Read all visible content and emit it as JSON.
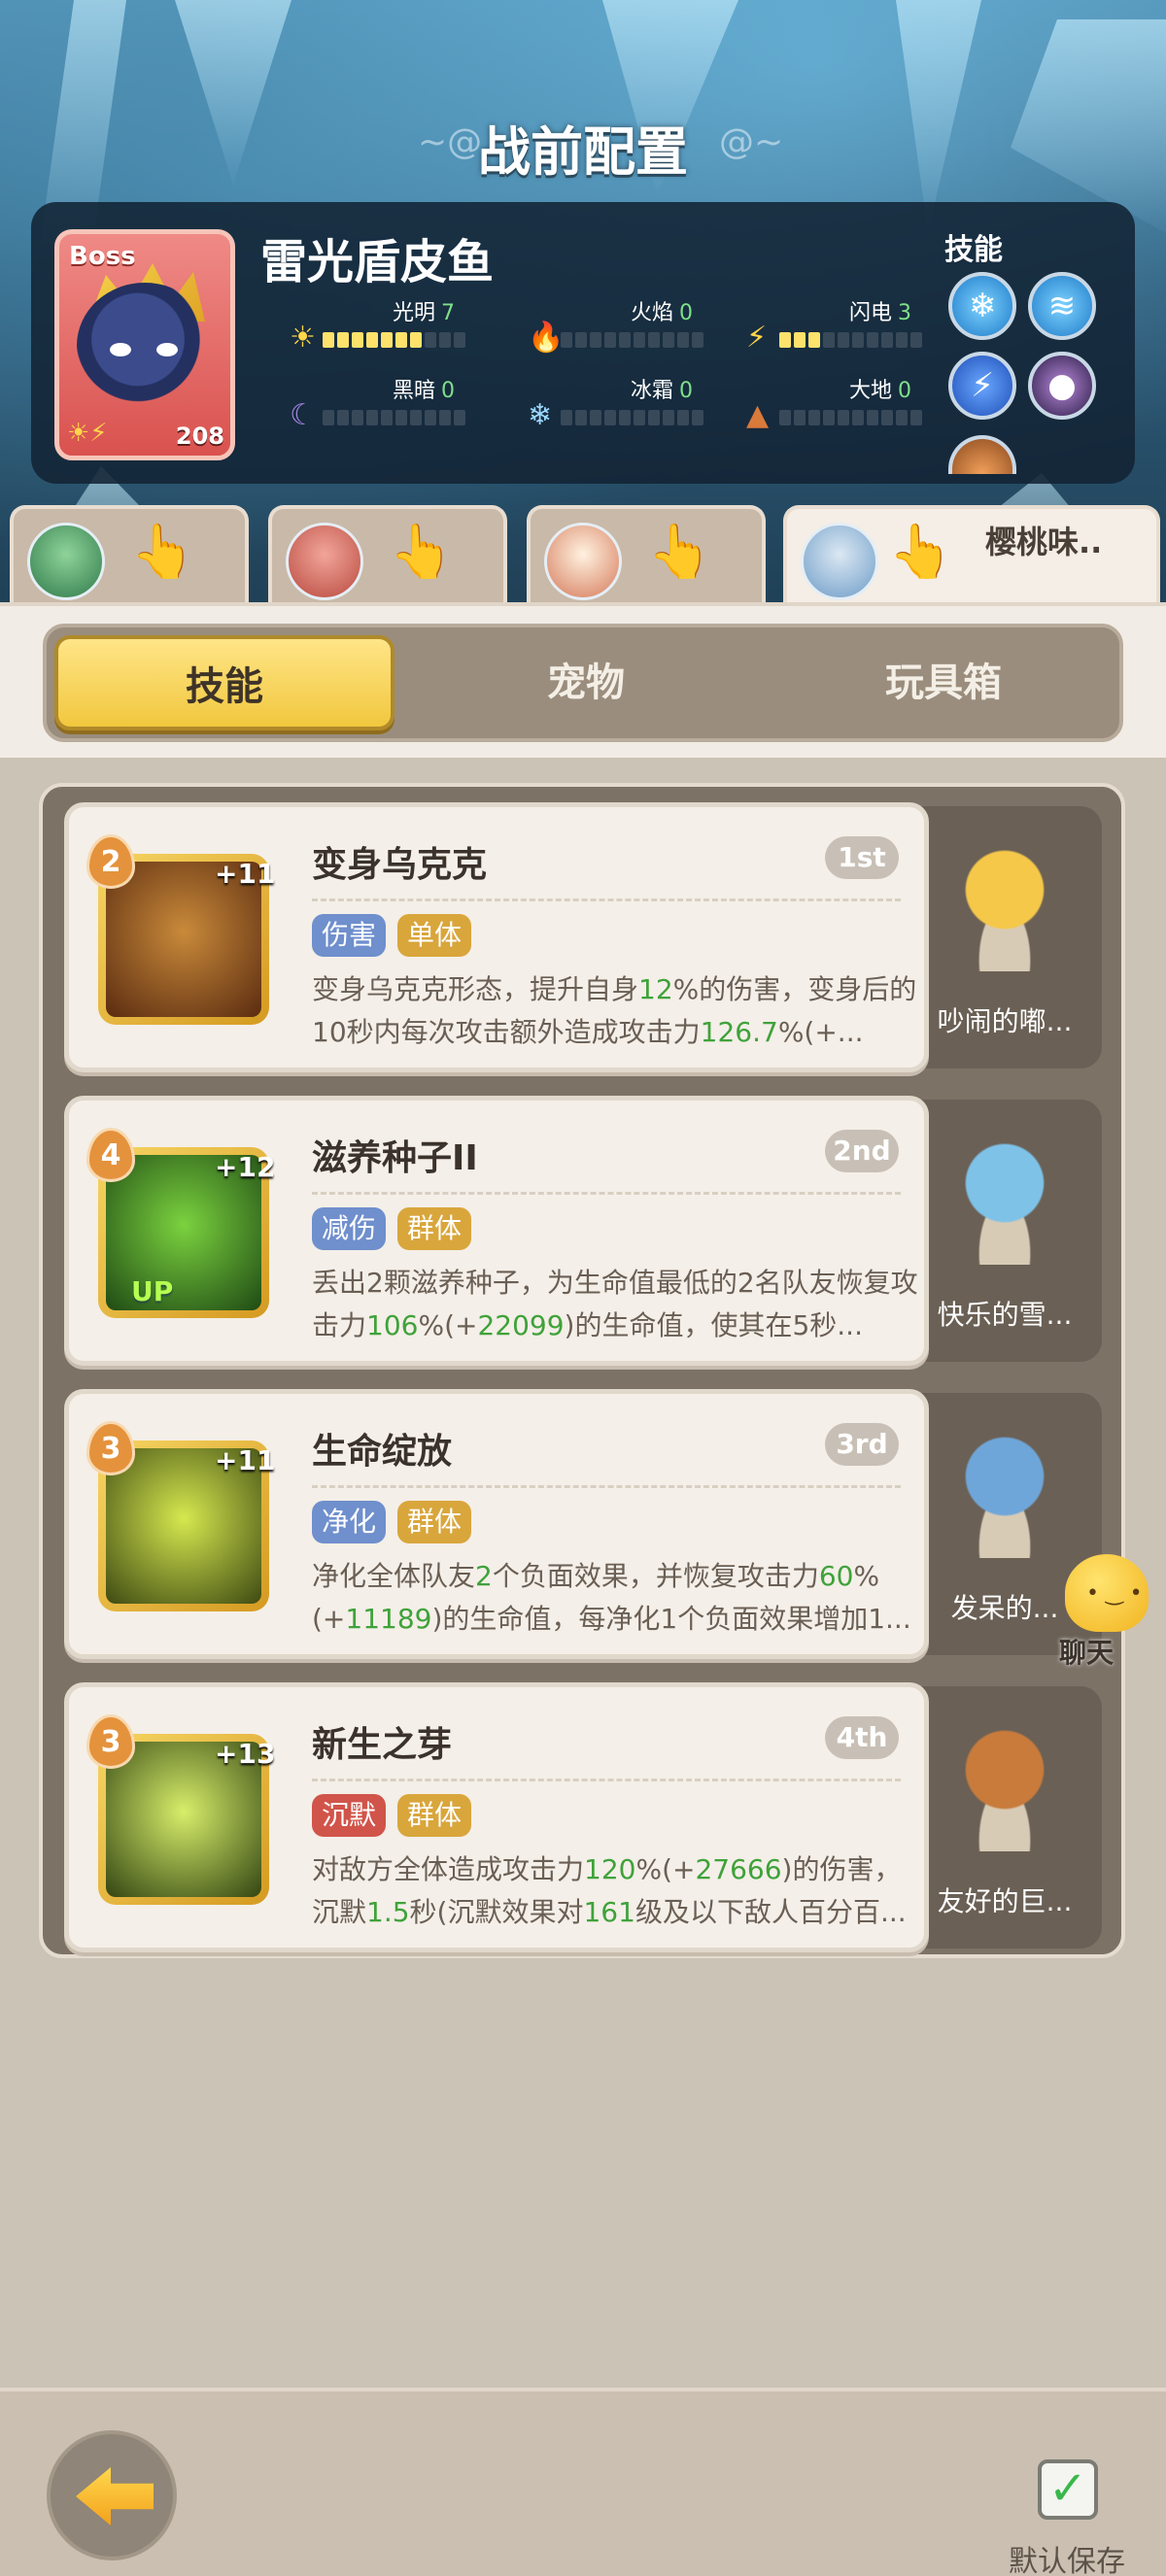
{
  "header": {
    "title": "战前配置"
  },
  "boss": {
    "badge": "Boss",
    "name": "雷光盾皮鱼",
    "level": "208",
    "stats": [
      {
        "label": "光明",
        "value": "7",
        "fill": 7,
        "icon": "sun-icon"
      },
      {
        "label": "火焰",
        "value": "0",
        "fill": 0,
        "icon": "fire-icon"
      },
      {
        "label": "闪电",
        "value": "3",
        "fill": 3,
        "icon": "lightning-icon"
      },
      {
        "label": "黑暗",
        "value": "0",
        "fill": 0,
        "icon": "moon-icon"
      },
      {
        "label": "冰霜",
        "value": "0",
        "fill": 0,
        "icon": "snowflake-icon"
      },
      {
        "label": "大地",
        "value": "0",
        "fill": 0,
        "icon": "earth-icon"
      }
    ],
    "skills_label": "技能"
  },
  "team": {
    "slots": [
      {
        "name": ""
      },
      {
        "name": ""
      },
      {
        "name": ""
      },
      {
        "name": "樱桃味.."
      }
    ]
  },
  "tabs": {
    "items": [
      "技能",
      "宠物",
      "玩具箱"
    ],
    "active": 0
  },
  "skills": [
    {
      "name": "变身乌克克",
      "rank": "1st",
      "level": "2",
      "plus": "+11",
      "tags": [
        {
          "text": "伤害",
          "color": "blue"
        },
        {
          "text": "单体",
          "color": "gold"
        }
      ],
      "desc": [
        {
          "t": "变身乌克克形态，提升自身"
        },
        {
          "t": "12",
          "g": true
        },
        {
          "t": "%的伤害，变身后的10秒内每次攻击额外造成攻击力"
        },
        {
          "t": "126.7",
          "g": true
        },
        {
          "t": "%(+..."
        }
      ],
      "pet": "吵闹的嘟..."
    },
    {
      "name": "滋养种子II",
      "rank": "2nd",
      "level": "4",
      "plus": "+12",
      "up": "UP",
      "tags": [
        {
          "text": "减伤",
          "color": "blue"
        },
        {
          "text": "群体",
          "color": "gold"
        }
      ],
      "desc": [
        {
          "t": "丢出2颗滋养种子，为生命值最低的2名队友恢复攻击力"
        },
        {
          "t": "106",
          "g": true
        },
        {
          "t": "%(+"
        },
        {
          "t": "22099",
          "g": true
        },
        {
          "t": ")的生命值，使其在5秒..."
        }
      ],
      "pet": "快乐的雪..."
    },
    {
      "name": "生命绽放",
      "rank": "3rd",
      "level": "3",
      "plus": "+11",
      "tags": [
        {
          "text": "净化",
          "color": "blue"
        },
        {
          "text": "群体",
          "color": "gold"
        }
      ],
      "desc": [
        {
          "t": "净化全体队友"
        },
        {
          "t": "2",
          "g": true
        },
        {
          "t": "个负面效果，并恢复攻击力"
        },
        {
          "t": "60",
          "g": true
        },
        {
          "t": "%(+"
        },
        {
          "t": "11189",
          "g": true
        },
        {
          "t": ")的生命值，每净化1个负面效果增加1..."
        }
      ],
      "pet": "发呆的..."
    },
    {
      "name": "新生之芽",
      "rank": "4th",
      "level": "3",
      "plus": "+13",
      "tags": [
        {
          "text": "沉默",
          "color": "red"
        },
        {
          "text": "群体",
          "color": "gold"
        }
      ],
      "desc": [
        {
          "t": "对敌方全体造成攻击力"
        },
        {
          "t": "120",
          "g": true
        },
        {
          "t": "%(+"
        },
        {
          "t": "27666",
          "g": true
        },
        {
          "t": ")的伤害，沉默"
        },
        {
          "t": "1.5",
          "g": true
        },
        {
          "t": "秒(沉默效果对"
        },
        {
          "t": "161",
          "g": true
        },
        {
          "t": "级及以下敌人百分百..."
        }
      ],
      "pet": "友好的巨..."
    }
  ],
  "chat": {
    "label": "聊天"
  },
  "footer": {
    "save_label": "默认保存"
  },
  "colors": {
    "accent": "#f1c73e",
    "highlight": "#3fa23a",
    "panel": "#122334"
  }
}
